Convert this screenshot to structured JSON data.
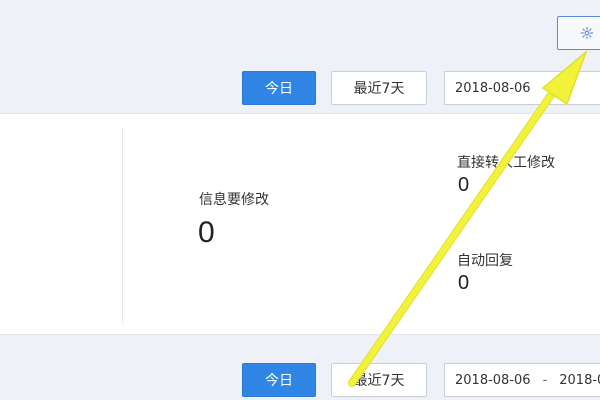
{
  "toolbar_top": {
    "today_label": "今日",
    "last7_label": "最近7天",
    "date_start": "2018-08-06"
  },
  "stats": {
    "info_modify": {
      "label": "信息要修改",
      "value": "0"
    },
    "direct_transfer": {
      "label": "直接转人工修改",
      "value": "0"
    },
    "auto_reply": {
      "label": "自动回复",
      "value": "0"
    }
  },
  "toolbar_bottom": {
    "today_label": "今日",
    "last7_label": "最近7天",
    "date_start": "2018-08-06",
    "date_sep": "-",
    "date_end": "2018-0"
  },
  "icons": {
    "settings": "gear-icon",
    "annotation": "yellow-arrow"
  },
  "colors": {
    "primary": "#2f86e4",
    "arrow": "#f2f23a",
    "background": "#eef1f7"
  }
}
